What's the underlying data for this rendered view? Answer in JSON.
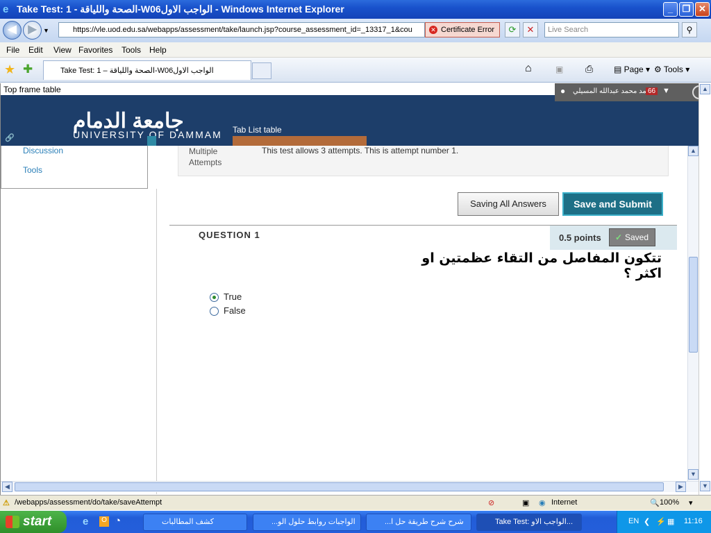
{
  "window": {
    "title": "Take Test: 1 - الصحة واللياقة-W06الواجب الاول - Windows Internet Explorer",
    "minimize": "_",
    "maximize": "❐",
    "close": "✕"
  },
  "toolbar": {
    "back": "◀",
    "forward": "▶",
    "address": "https://vle.uod.edu.sa/webapps/assessment/take/launch.jsp?course_assessment_id=_13317_1&cou",
    "certificate_error": "Certificate Error",
    "search_placeholder": "Live Search"
  },
  "menu": [
    "File",
    "Edit",
    "View",
    "Favorites",
    "Tools",
    "Help"
  ],
  "tabs": {
    "active_tab": "Take Test: 1 – الصحة واللياقة-W06الواجب الاول",
    "page_label": "Page",
    "tools_label": "Tools"
  },
  "page": {
    "top_frame_label": "Top frame table",
    "user_name": "احمد محمد عبدالله المسيلي",
    "notification_count": "66",
    "logo_arabic": "جامعة الدمام",
    "logo_english": "UNIVERSITY OF DAMMAM",
    "tab_list_label": "Tab List table",
    "left_nav": [
      "Discussion",
      "Tools"
    ],
    "attempts_label": "Multiple Attempts",
    "attempts_text": "This test allows 3 attempts. This is attempt number 1.",
    "saving_button": "Saving All Answers",
    "submit_button": "Save and Submit",
    "question_label": "QUESTION 1",
    "points": "0.5 points",
    "saved_label": "Saved",
    "question_text": "تتكون المفاصل من التقاء عظمتين او اكثر ؟",
    "options": [
      {
        "label": "True",
        "selected": true
      },
      {
        "label": "False",
        "selected": false
      }
    ]
  },
  "statusbar": {
    "url": "/webapps/assessment/do/take/saveAttempt",
    "zone": "Internet",
    "zoom": "100%"
  },
  "taskbar": {
    "start": "start",
    "buttons": [
      {
        "label": "كشف المطالبات",
        "active": false
      },
      {
        "label": "...الواجبات روابط حلول الو",
        "active": false
      },
      {
        "label": "...شرح شرح طريقة حل ا",
        "active": false
      },
      {
        "label": "Take Test: الواجب الاو...",
        "active": true
      }
    ],
    "language": "EN",
    "clock": "11:16"
  }
}
